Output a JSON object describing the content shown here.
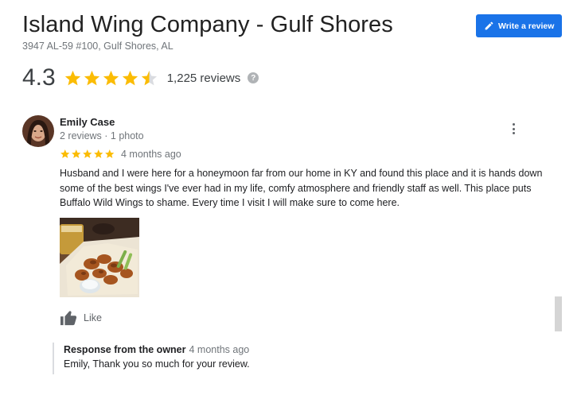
{
  "business": {
    "name": "Island Wing Company - Gulf Shores",
    "address": "3947 AL-59 #100, Gulf Shores, AL"
  },
  "write_review_button": {
    "label": "Write a review",
    "icon": "pencil-icon"
  },
  "summary": {
    "rating": "4.3",
    "rating_numeric": 4.3,
    "stars_full": 4,
    "star_partial_fraction": 0.5,
    "review_count": "1,225 reviews",
    "help_icon": "?"
  },
  "review": {
    "reviewer_name": "Emily Case",
    "reviewer_meta": "2 reviews · 1 photo",
    "stars": 5,
    "date": "4 months ago",
    "text": "Husband and I were here for a honeymoon far from our home in KY and found this place and it is hands down some of the best wings I've ever had in my life, comfy atmosphere and friendly staff as well. This place puts Buffalo Wild Wings to shame. Every time I visit I will make sure to come here.",
    "like_label": "Like",
    "more_icon": "more-vert-icon"
  },
  "owner_response": {
    "title": "Response from the owner",
    "date": "4 months ago",
    "text": "Emily, Thank you so much for your review."
  },
  "colors": {
    "star": "#fbbc04",
    "star_empty": "#dadce0",
    "accent": "#1a73e8",
    "text_primary": "#202124",
    "text_secondary": "#70757a"
  }
}
